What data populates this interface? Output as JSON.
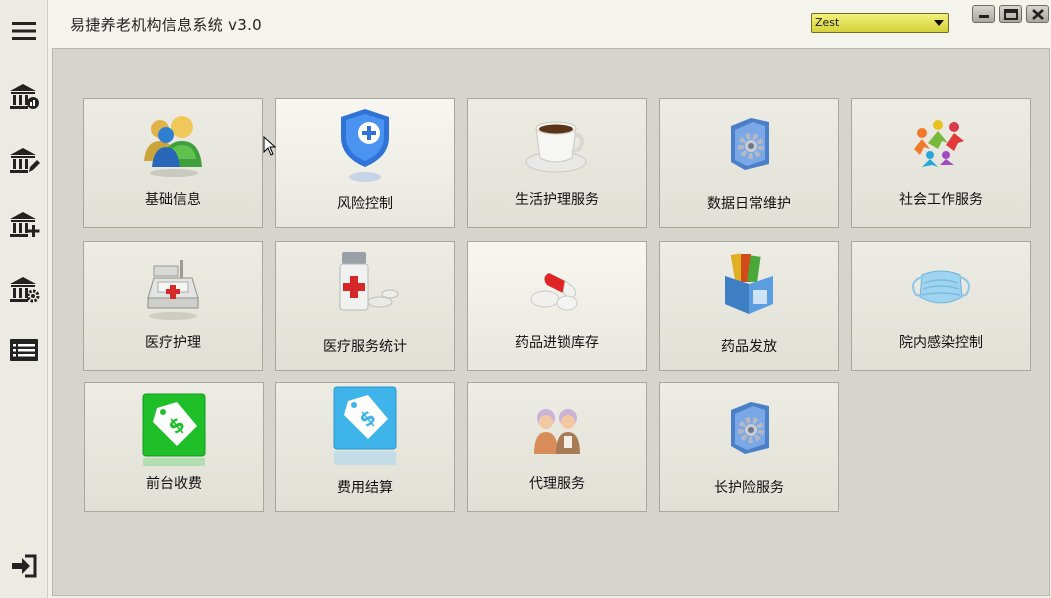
{
  "app": {
    "title": "易捷养老机构信息系统 v3.0"
  },
  "theme_select": {
    "value": "Zest"
  },
  "window_controls": [
    "minimize",
    "maximize",
    "close"
  ],
  "sidebar": {
    "items": [
      {
        "icon": "menu-icon"
      },
      {
        "icon": "bank-chart-icon"
      },
      {
        "icon": "bank-edit-icon"
      },
      {
        "icon": "bank-add-icon"
      },
      {
        "icon": "bank-settings-icon"
      },
      {
        "icon": "list-icon"
      },
      {
        "icon": "logout-icon"
      }
    ]
  },
  "tiles": [
    {
      "label": "基础信息",
      "icon": "users-icon"
    },
    {
      "label": "风险控制",
      "icon": "shield-plus-icon"
    },
    {
      "label": "生活护理服务",
      "icon": "coffee-cup-icon"
    },
    {
      "label": "数据日常维护",
      "icon": "folder-gear-icon"
    },
    {
      "label": "社会工作服务",
      "icon": "community-people-icon"
    },
    {
      "label": "医疗护理",
      "icon": "medical-device-icon"
    },
    {
      "label": "医疗服务统计",
      "icon": "medicine-bottle-icon"
    },
    {
      "label": "药品进锁库存",
      "icon": "pills-icon"
    },
    {
      "label": "药品发放",
      "icon": "box-books-icon"
    },
    {
      "label": "院内感染控制",
      "icon": "face-mask-icon"
    },
    {
      "label": "前台收费",
      "icon": "green-price-tag-icon"
    },
    {
      "label": "费用结算",
      "icon": "blue-price-tag-icon"
    },
    {
      "label": "代理服务",
      "icon": "elderly-couple-icon"
    },
    {
      "label": "长护险服务",
      "icon": "folder-gear-icon"
    }
  ],
  "colors": {
    "accent_select": "#e6e35a",
    "tile_bg": "#e7e6dd",
    "panel_bg": "#d6d5cd"
  }
}
